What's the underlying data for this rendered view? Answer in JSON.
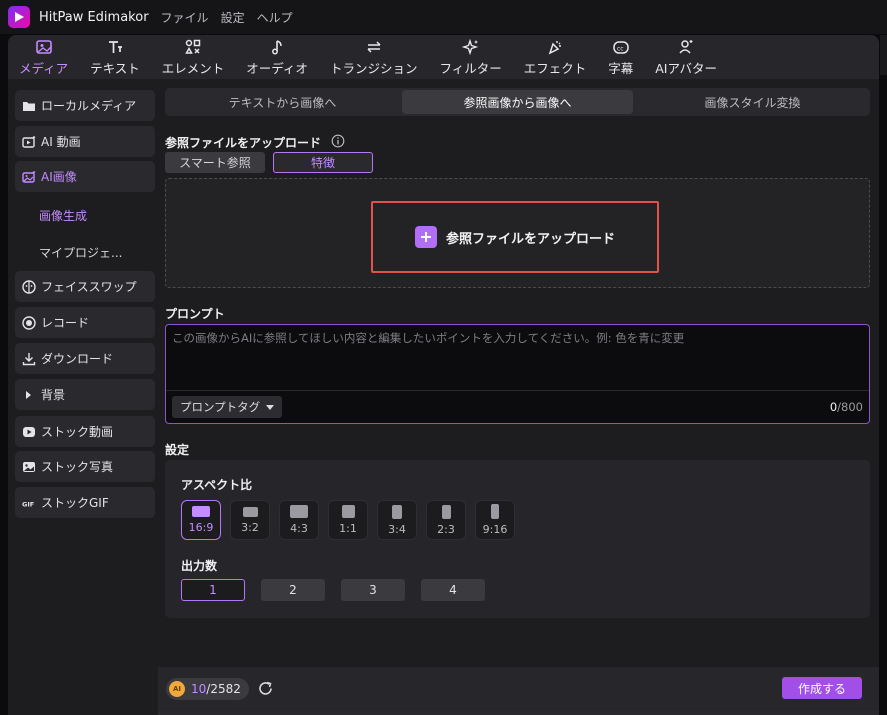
{
  "titlebar": {
    "app_name": "HitPaw Edimakor",
    "menus": [
      "ファイル",
      "設定",
      "ヘルプ"
    ]
  },
  "toolbar": {
    "items": [
      {
        "label": "メディア",
        "icon": "media-icon",
        "active": true
      },
      {
        "label": "テキスト",
        "icon": "text-icon"
      },
      {
        "label": "エレメント",
        "icon": "elements-icon"
      },
      {
        "label": "オーディオ",
        "icon": "audio-icon"
      },
      {
        "label": "トランジション",
        "icon": "transition-icon"
      },
      {
        "label": "フィルター",
        "icon": "filter-icon"
      },
      {
        "label": "エフェクト",
        "icon": "effect-icon"
      },
      {
        "label": "字幕",
        "icon": "subtitle-icon"
      },
      {
        "label": "AIアバター",
        "icon": "ai-avatar-icon"
      }
    ]
  },
  "sidebar": {
    "items": [
      {
        "label": "ローカルメディア",
        "icon": "folder-icon"
      },
      {
        "label": "AI 動画",
        "icon": "ai-video-icon"
      },
      {
        "label": "AI画像",
        "icon": "ai-image-icon",
        "active": true
      },
      {
        "label": "フェイススワップ",
        "icon": "face-swap-icon"
      },
      {
        "label": "レコード",
        "icon": "record-icon"
      },
      {
        "label": "ダウンロード",
        "icon": "download-icon"
      },
      {
        "label": "背景",
        "icon": "caret-right-icon"
      },
      {
        "label": "ストック動画",
        "icon": "stock-video-icon"
      },
      {
        "label": "ストック写真",
        "icon": "stock-photo-icon"
      },
      {
        "label": "ストックGIF",
        "icon": "gif-icon"
      }
    ],
    "subitems": [
      {
        "label": "画像生成",
        "active": true
      },
      {
        "label": "マイプロジェ..."
      }
    ]
  },
  "main": {
    "tabs": [
      {
        "label": "テキストから画像へ"
      },
      {
        "label": "参照画像から画像へ",
        "active": true
      },
      {
        "label": "画像スタイル変換"
      }
    ],
    "upload_section_label": "参照ファイルをアップロード",
    "modes": {
      "smart": "スマート参照",
      "feature": "特徴"
    },
    "upload_button": "参照ファイルをアップロード",
    "prompt": {
      "label": "プロンプト",
      "placeholder": "この画像からAIに参照してほしい内容と編集したいポイントを入力してください。例: 色を青に変更",
      "value": "",
      "tag_button": "プロンプトタグ",
      "count_current": "0",
      "count_max": "/800"
    },
    "settings": {
      "label": "設定",
      "aspect_label": "アスペクト比",
      "aspects": [
        "16:9",
        "3:2",
        "4:3",
        "1:1",
        "3:4",
        "2:3",
        "9:16"
      ],
      "aspect_selected": "16:9",
      "output_label": "出力数",
      "outputs": [
        "1",
        "2",
        "3",
        "4"
      ],
      "output_selected": "1"
    }
  },
  "bottombar": {
    "coin_label": "AI",
    "credits_used": "10",
    "credits_total": "/2582",
    "create_button": "作成する"
  },
  "colors": {
    "accent": "#b478f5",
    "create": "#a24fe8",
    "upload_border": "#e0524b"
  }
}
